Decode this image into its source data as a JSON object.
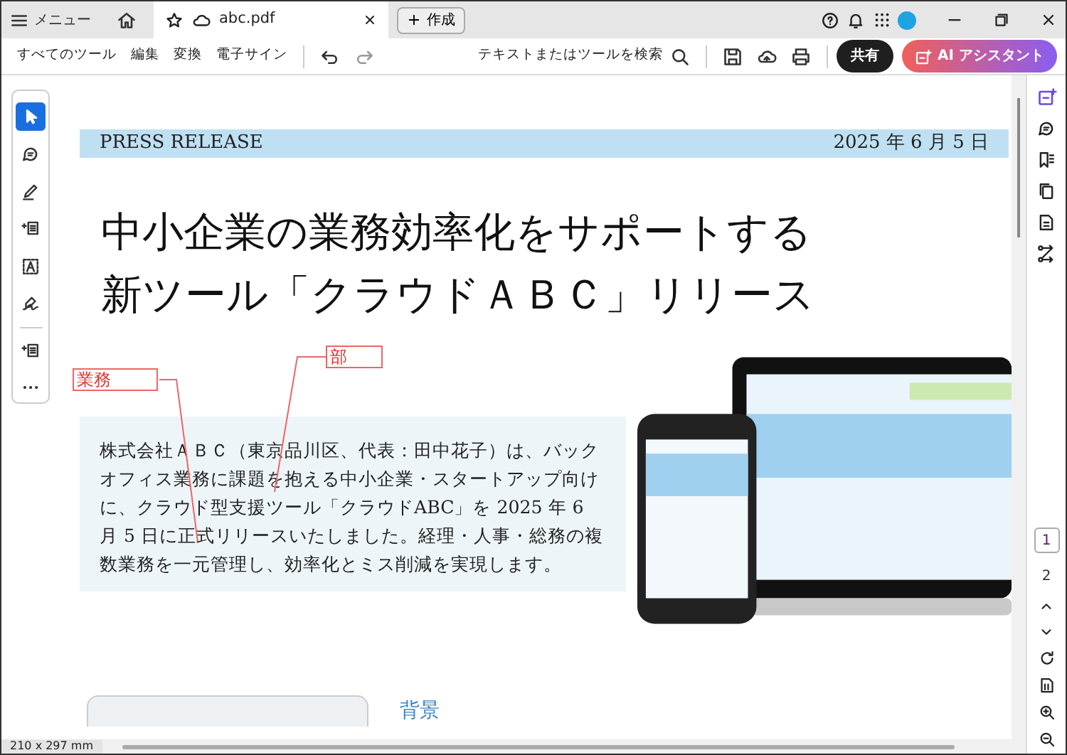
{
  "title_bar": {
    "menu_label": "メニュー",
    "tabs": [
      {
        "label": "abc.pdf",
        "selected": true
      }
    ],
    "create_button": "作成"
  },
  "toolbar": {
    "menu_items": [
      "すべてのツール",
      "編集",
      "変換",
      "電子サイン"
    ],
    "search_label": "テキストまたはツールを検索",
    "share_button": "共有",
    "ai_button": "AI アシスタント"
  },
  "left_tools": [
    {
      "kind": "select",
      "selected": true
    },
    {
      "kind": "comment",
      "selected": false
    },
    {
      "kind": "draw",
      "selected": false
    },
    {
      "kind": "insert",
      "selected": false
    },
    {
      "kind": "text",
      "selected": false
    },
    {
      "kind": "sign",
      "selected": false
    },
    {
      "kind": "insert",
      "selected": false
    },
    {
      "kind": "more",
      "selected": false
    }
  ],
  "document": {
    "header_label": "PRESS RELEASE",
    "date": "2025 年 6 月 5 日",
    "headline": [
      "中小企業の業務効率化をサポートする",
      "新ツール「クラウドＡＢＣ」リリース"
    ],
    "annotations": [
      {
        "text": "業務"
      },
      {
        "text": "部"
      }
    ],
    "body": "株式会社ＡＢＣ（東京品川区、代表：田中花子）は、バックオフィス業務に課題を抱える中小企業・スタートアップ向けに、クラウド型支援ツール「クラウドABC」を 2025 年 6 月 5 日に正式リリースいたしました。経理・人事・総務の複数業務を一元管理し、効率化とミス削減を実現します。",
    "section_heading": "背景"
  },
  "page_nav": {
    "pages": [
      {
        "label": "1",
        "selected": true
      },
      {
        "label": "2",
        "selected": false
      }
    ]
  },
  "status_bar": {
    "page_size": "210 x 297 mm"
  }
}
